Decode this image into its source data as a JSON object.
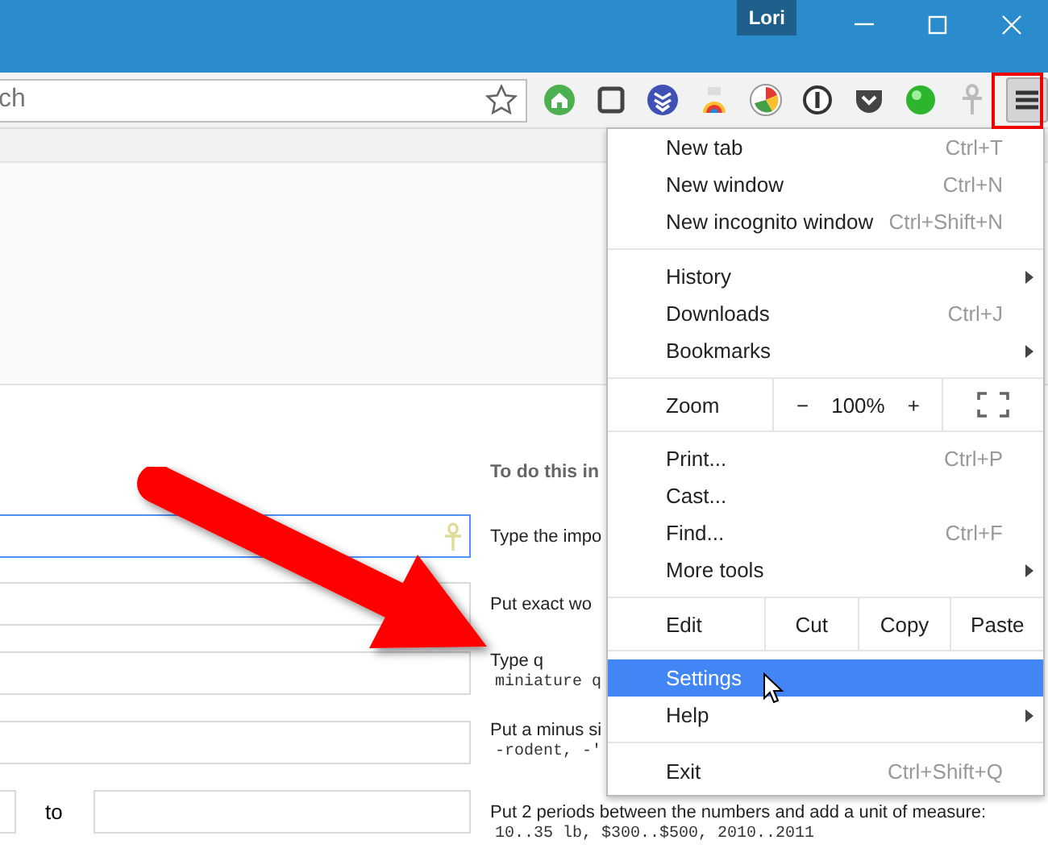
{
  "window": {
    "profile": "Lori"
  },
  "toolbar": {
    "address": {
      "placeholder": "ch"
    },
    "menu_button": {
      "highlighted": true
    }
  },
  "page": {
    "heading": "To do this in",
    "rows": [
      {
        "kind": "field",
        "focused": true,
        "hint": "Type the impo"
      },
      {
        "kind": "field",
        "focused": false,
        "hint": "Put exact wo"
      },
      {
        "kind": "field",
        "focused": false,
        "hint": "Type q",
        "example": "miniature q"
      },
      {
        "kind": "field",
        "focused": false,
        "hint": "Put a minus si",
        "example": "-rodent, -'"
      },
      {
        "kind": "range",
        "focused": false,
        "between": "to",
        "hint": "Put 2 periods between the numbers and add a unit of measure:",
        "example": "10..35 lb, $300..$500, 2010..2011"
      }
    ]
  },
  "menu": {
    "sections": [
      {
        "items": [
          {
            "kind": "item",
            "label": "New tab",
            "shortcut": "Ctrl+T",
            "submenu": false,
            "selected": false
          },
          {
            "kind": "item",
            "label": "New window",
            "shortcut": "Ctrl+N",
            "submenu": false,
            "selected": false
          },
          {
            "kind": "item",
            "label": "New incognito window",
            "shortcut": "Ctrl+Shift+N",
            "submenu": false,
            "selected": false
          }
        ]
      },
      {
        "items": [
          {
            "kind": "item",
            "label": "History",
            "submenu": true,
            "selected": false
          },
          {
            "kind": "item",
            "label": "Downloads",
            "shortcut": "Ctrl+J",
            "submenu": false,
            "selected": false
          },
          {
            "kind": "item",
            "label": "Bookmarks",
            "submenu": true,
            "selected": false
          }
        ]
      },
      {
        "items": [
          {
            "kind": "zoom",
            "label": "Zoom",
            "minus": "−",
            "value": "100%",
            "plus": "+"
          }
        ]
      },
      {
        "items": [
          {
            "kind": "item",
            "label": "Print...",
            "shortcut": "Ctrl+P",
            "submenu": false,
            "selected": false
          },
          {
            "kind": "item",
            "label": "Cast...",
            "submenu": false,
            "selected": false
          },
          {
            "kind": "item",
            "label": "Find...",
            "shortcut": "Ctrl+F",
            "submenu": false,
            "selected": false
          },
          {
            "kind": "item",
            "label": "More tools",
            "submenu": true,
            "selected": false
          }
        ]
      },
      {
        "items": [
          {
            "kind": "edit",
            "label": "Edit",
            "buttons": [
              "Cut",
              "Copy",
              "Paste"
            ]
          }
        ]
      },
      {
        "items": [
          {
            "kind": "item",
            "label": "Settings",
            "submenu": false,
            "selected": true
          },
          {
            "kind": "item",
            "label": "Help",
            "submenu": true,
            "selected": false
          }
        ]
      },
      {
        "items": [
          {
            "kind": "item",
            "label": "Exit",
            "shortcut": "Ctrl+Shift+Q",
            "submenu": false,
            "selected": false
          }
        ]
      }
    ]
  }
}
